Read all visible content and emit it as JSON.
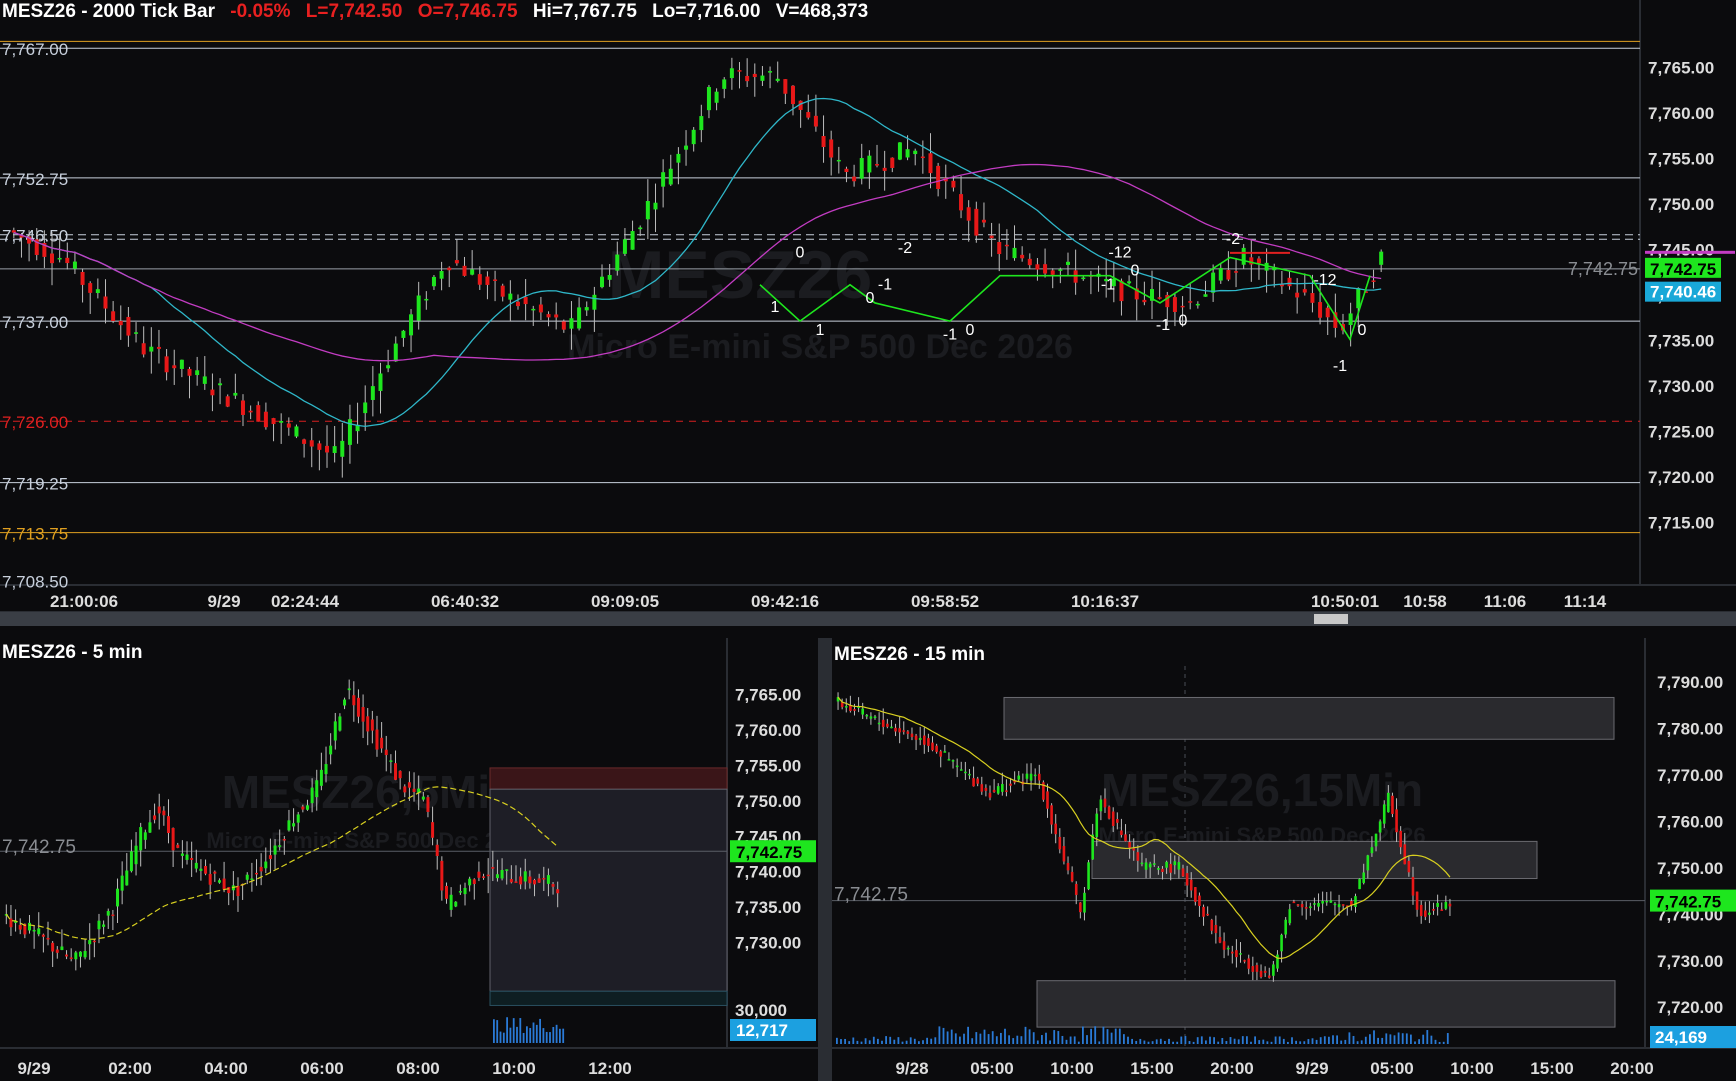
{
  "colors": {
    "up": "#1ee61e",
    "down": "#e81818",
    "bg": "#0b0b0d",
    "ema": "#2fb7c9",
    "sma": "#c23cc2",
    "yellow": "#d8d020",
    "orange": "#e0a020",
    "redline": "#d62020",
    "grid": "#c8d0dc"
  },
  "main": {
    "header": {
      "symbol": "MESZ26 - 2000 Tick Bar",
      "change": "-0.05%",
      "last": "L=7,742.50",
      "open": "O=7,746.75",
      "high": "Hi=7,767.75",
      "low": "Lo=7,716.00",
      "volume": "V=468,373"
    },
    "watermark": {
      "big": "MESZ26",
      "small": "Micro E-mini S&P 500 Dec 2026"
    },
    "price_labels": [
      "7,765.00",
      "7,760.00",
      "7,755.00",
      "7,750.00",
      "7,745.00",
      "7,740.00",
      "7,735.00",
      "7,730.00",
      "7,725.00",
      "7,720.00",
      "7,715.00"
    ],
    "time_labels": [
      "21:00:06",
      "9/29",
      "02:24:44",
      "06:40:32",
      "09:09:05",
      "09:42:16",
      "09:58:52",
      "10:16:37",
      "10:50:01",
      "10:58",
      "11:06",
      "11:14"
    ],
    "left_levels": [
      {
        "text": "7,767.00",
        "color": "#c8d0dc"
      },
      {
        "text": "7,752.75",
        "color": "#c8d0dc"
      },
      {
        "text": "7,746.50",
        "color": "#c8d0dc"
      },
      {
        "text": "7,737.00",
        "color": "#c8d0dc"
      },
      {
        "text": "7,726.00",
        "color": "#e02020"
      },
      {
        "text": "7,719.25",
        "color": "#c8d0dc"
      },
      {
        "text": "7,713.75",
        "color": "#e0a020"
      },
      {
        "text": "7,708.50",
        "color": "#c8d0dc"
      }
    ],
    "right_last": "7,742.75",
    "badge_green": "7,742.75",
    "badge_blue": "7,740.46",
    "annotations": [
      "0",
      "1",
      "1",
      "-2",
      "-1",
      "0",
      "-1",
      "0",
      "-12",
      "-1",
      "0",
      "-2",
      "0",
      "-1",
      "-12",
      "-1",
      "0"
    ]
  },
  "chart_data": [
    {
      "type": "candlestick",
      "title": "MESZ26 - 2000 Tick Bar",
      "ylim": [
        7708,
        7769
      ],
      "y_ticks": [
        7715,
        7720,
        7725,
        7730,
        7735,
        7740,
        7745,
        7750,
        7755,
        7760,
        7765
      ],
      "x_ticks": [
        "21:00:06",
        "9/29",
        "02:24:44",
        "06:40:32",
        "09:09:05",
        "09:42:16",
        "09:58:52",
        "10:16:37",
        "10:50:01",
        "10:58",
        "11:06",
        "11:14"
      ],
      "levels": [
        7767.75,
        7767,
        7752.75,
        7746.5,
        7746,
        7742.75,
        7737,
        7726,
        7719.25,
        7713.75
      ],
      "last": 7742.75,
      "ema": 7740.46
    },
    {
      "type": "candlestick",
      "title": "MESZ26 - 5 min",
      "ylim": [
        7715,
        7770
      ],
      "y_ticks": [
        7730,
        7735,
        7740,
        7745,
        7750,
        7755,
        7760,
        7765
      ],
      "x_ticks": [
        "9/29",
        "02:00",
        "04:00",
        "06:00",
        "08:00",
        "10:00",
        "12:00"
      ],
      "volume_tick": "30,000",
      "volume_last": "12,717",
      "last": 7742.75
    },
    {
      "type": "candlestick",
      "title": "MESZ26 - 15 min",
      "ylim": [
        7711,
        7795
      ],
      "y_ticks": [
        7720,
        7730,
        7740,
        7750,
        7760,
        7770,
        7780,
        7790
      ],
      "x_ticks": [
        "9/28",
        "05:00",
        "10:00",
        "15:00",
        "20:00",
        "9/29",
        "05:00",
        "10:00",
        "15:00",
        "20:00"
      ],
      "volume_last": "24,169",
      "last": 7742.75
    }
  ],
  "five": {
    "header": "MESZ26 - 5 min",
    "wm_big": "MESZ26,5Min",
    "wm_small": "Micro E-mini S&P 500 Dec 2026",
    "left_last": "7,742.75",
    "price_labels": [
      "7,765.00",
      "7,760.00",
      "7,755.00",
      "7,750.00",
      "7,745.00",
      "7,740.00",
      "7,735.00",
      "7,730.00"
    ],
    "badge": "7,742.75",
    "vol_label": "30,000",
    "vol_badge": "12,717",
    "time_labels": [
      "9/29",
      "02:00",
      "04:00",
      "06:00",
      "08:00",
      "10:00",
      "12:00"
    ]
  },
  "fifteen": {
    "header": "MESZ26 - 15 min",
    "wm_big": "MESZ26,15Min",
    "wm_small": "Micro E-mini S&P 500 Dec 2026",
    "left_last": "7,742.75",
    "price_labels": [
      "7,790.00",
      "7,780.00",
      "7,770.00",
      "7,760.00",
      "7,750.00",
      "7,740.00",
      "7,730.00",
      "7,720.00"
    ],
    "badge": "7,742.75",
    "vol_badge": "24,169",
    "time_labels": [
      "9/28",
      "05:00",
      "10:00",
      "15:00",
      "20:00",
      "9/29",
      "05:00",
      "10:00",
      "15:00",
      "20:00"
    ]
  }
}
